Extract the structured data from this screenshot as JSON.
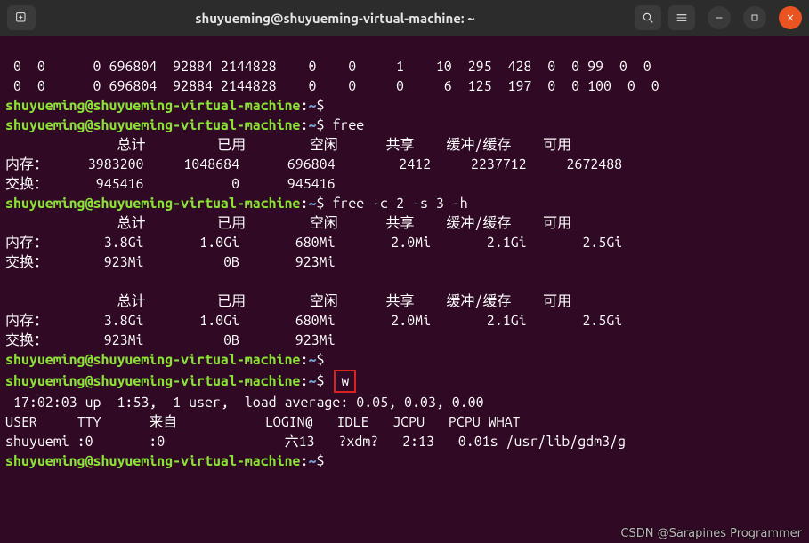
{
  "titlebar": {
    "title": "shuyueming@shuyueming-virtual-machine: ~"
  },
  "icons": {
    "newtab": "new-tab-icon",
    "search": "search-icon",
    "menu": "hamburger-icon",
    "min": "minimize-icon",
    "max": "maximize-icon",
    "close": "close-icon"
  },
  "prompt": {
    "user_host": "shuyueming@shuyueming-virtual-machine",
    "sep": ":",
    "cwd": "~",
    "sigil": "$"
  },
  "vmstat": {
    "row1": " 0  0      0 696804  92884 2144828    0    0     1    10  295  428  0  0 99  0  0",
    "row2": " 0  0      0 696804  92884 2144828    0    0     0     6  125  197  0  0 100  0  0"
  },
  "cmds": {
    "empty": "",
    "free": " free",
    "free2": " free -c 2 -s 3 -h",
    "w": "w"
  },
  "free_plain": {
    "header": "              总计         已用        空闲      共享    缓冲/缓存    可用",
    "mem": "内存：     3983200     1048684      696804        2412     2237712     2672488",
    "swap": "交换：      945416           0      945416"
  },
  "free_h": {
    "header": "              总计         已用        空闲      共享    缓冲/缓存    可用",
    "mem": "内存：       3.8Gi       1.0Gi       680Mi       2.0Mi       2.1Gi       2.5Gi",
    "swap": "交换：       923Mi          0B       923Mi"
  },
  "w_output": {
    "uptime": " 17:02:03 up  1:53,  1 user,  load average: 0.05, 0.03, 0.00",
    "header": "USER     TTY      来自           LOGIN@   IDLE   JCPU   PCPU WHAT",
    "row": "shuyuemi :0       :0               六13   ?xdm?   2:13   0.01s /usr/lib/gdm3/g"
  },
  "watermark": "CSDN @Sarapines Programmer"
}
